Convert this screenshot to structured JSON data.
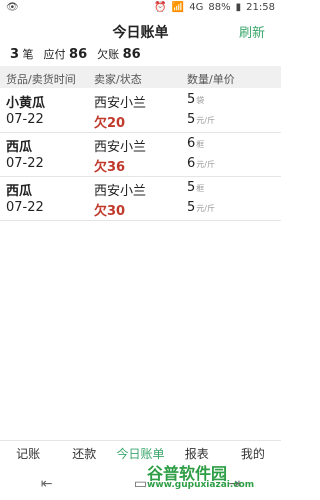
{
  "status_bar": {
    "left_icon": "eye-icon",
    "network": "4G",
    "battery": "88%",
    "time": "21:58"
  },
  "header": {
    "title": "今日账单",
    "refresh_label": "刷新"
  },
  "summary": {
    "count_value": "3",
    "count_unit": "笔",
    "payable_label": "应付",
    "payable_value": "86",
    "owed_label": "欠账",
    "owed_value": "86"
  },
  "table": {
    "headers": [
      "货品/卖货时间",
      "卖家/状态",
      "数量/单价"
    ],
    "rows": [
      {
        "product": "小黄瓜",
        "date": "07-22",
        "seller": "西安小兰",
        "status": "欠20",
        "qty": "5",
        "qty_unit": "袋",
        "price": "5",
        "price_unit": "元/斤"
      },
      {
        "product": "西瓜",
        "date": "07-22",
        "seller": "西安小兰",
        "status": "欠36",
        "qty": "6",
        "qty_unit": "框",
        "price": "6",
        "price_unit": "元/斤"
      },
      {
        "product": "西瓜",
        "date": "07-22",
        "seller": "西安小兰",
        "status": "欠30",
        "qty": "5",
        "qty_unit": "框",
        "price": "5",
        "price_unit": "元/斤"
      }
    ]
  },
  "bottom_nav": {
    "tabs": [
      "记账",
      "还款",
      "今日账单",
      "报表",
      "我的"
    ],
    "active_index": 2
  },
  "watermark": {
    "text": "谷普软件园",
    "url": "www.gupuxiazai.com"
  },
  "colors": {
    "accent": "#3aa56b",
    "debt": "#c0392b"
  }
}
